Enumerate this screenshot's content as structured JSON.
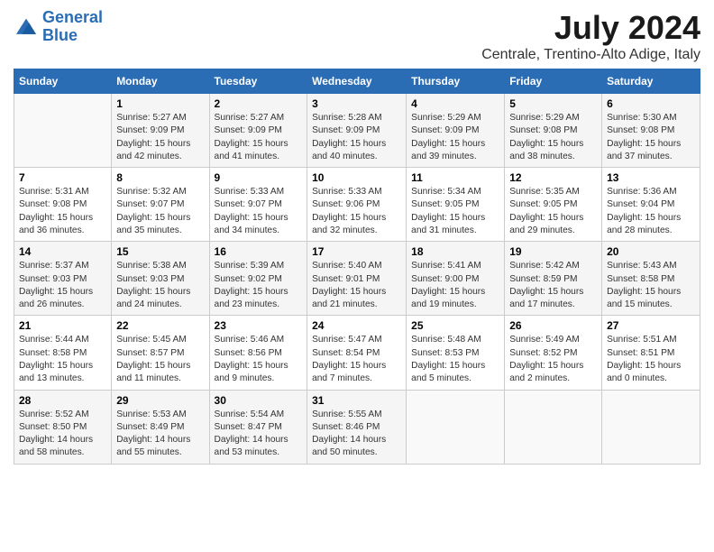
{
  "header": {
    "logo_line1": "General",
    "logo_line2": "Blue",
    "month": "July 2024",
    "location": "Centrale, Trentino-Alto Adige, Italy"
  },
  "weekdays": [
    "Sunday",
    "Monday",
    "Tuesday",
    "Wednesday",
    "Thursday",
    "Friday",
    "Saturday"
  ],
  "weeks": [
    [
      {
        "day": "",
        "info": ""
      },
      {
        "day": "1",
        "info": "Sunrise: 5:27 AM\nSunset: 9:09 PM\nDaylight: 15 hours\nand 42 minutes."
      },
      {
        "day": "2",
        "info": "Sunrise: 5:27 AM\nSunset: 9:09 PM\nDaylight: 15 hours\nand 41 minutes."
      },
      {
        "day": "3",
        "info": "Sunrise: 5:28 AM\nSunset: 9:09 PM\nDaylight: 15 hours\nand 40 minutes."
      },
      {
        "day": "4",
        "info": "Sunrise: 5:29 AM\nSunset: 9:09 PM\nDaylight: 15 hours\nand 39 minutes."
      },
      {
        "day": "5",
        "info": "Sunrise: 5:29 AM\nSunset: 9:08 PM\nDaylight: 15 hours\nand 38 minutes."
      },
      {
        "day": "6",
        "info": "Sunrise: 5:30 AM\nSunset: 9:08 PM\nDaylight: 15 hours\nand 37 minutes."
      }
    ],
    [
      {
        "day": "7",
        "info": "Sunrise: 5:31 AM\nSunset: 9:08 PM\nDaylight: 15 hours\nand 36 minutes."
      },
      {
        "day": "8",
        "info": "Sunrise: 5:32 AM\nSunset: 9:07 PM\nDaylight: 15 hours\nand 35 minutes."
      },
      {
        "day": "9",
        "info": "Sunrise: 5:33 AM\nSunset: 9:07 PM\nDaylight: 15 hours\nand 34 minutes."
      },
      {
        "day": "10",
        "info": "Sunrise: 5:33 AM\nSunset: 9:06 PM\nDaylight: 15 hours\nand 32 minutes."
      },
      {
        "day": "11",
        "info": "Sunrise: 5:34 AM\nSunset: 9:05 PM\nDaylight: 15 hours\nand 31 minutes."
      },
      {
        "day": "12",
        "info": "Sunrise: 5:35 AM\nSunset: 9:05 PM\nDaylight: 15 hours\nand 29 minutes."
      },
      {
        "day": "13",
        "info": "Sunrise: 5:36 AM\nSunset: 9:04 PM\nDaylight: 15 hours\nand 28 minutes."
      }
    ],
    [
      {
        "day": "14",
        "info": "Sunrise: 5:37 AM\nSunset: 9:03 PM\nDaylight: 15 hours\nand 26 minutes."
      },
      {
        "day": "15",
        "info": "Sunrise: 5:38 AM\nSunset: 9:03 PM\nDaylight: 15 hours\nand 24 minutes."
      },
      {
        "day": "16",
        "info": "Sunrise: 5:39 AM\nSunset: 9:02 PM\nDaylight: 15 hours\nand 23 minutes."
      },
      {
        "day": "17",
        "info": "Sunrise: 5:40 AM\nSunset: 9:01 PM\nDaylight: 15 hours\nand 21 minutes."
      },
      {
        "day": "18",
        "info": "Sunrise: 5:41 AM\nSunset: 9:00 PM\nDaylight: 15 hours\nand 19 minutes."
      },
      {
        "day": "19",
        "info": "Sunrise: 5:42 AM\nSunset: 8:59 PM\nDaylight: 15 hours\nand 17 minutes."
      },
      {
        "day": "20",
        "info": "Sunrise: 5:43 AM\nSunset: 8:58 PM\nDaylight: 15 hours\nand 15 minutes."
      }
    ],
    [
      {
        "day": "21",
        "info": "Sunrise: 5:44 AM\nSunset: 8:58 PM\nDaylight: 15 hours\nand 13 minutes."
      },
      {
        "day": "22",
        "info": "Sunrise: 5:45 AM\nSunset: 8:57 PM\nDaylight: 15 hours\nand 11 minutes."
      },
      {
        "day": "23",
        "info": "Sunrise: 5:46 AM\nSunset: 8:56 PM\nDaylight: 15 hours\nand 9 minutes."
      },
      {
        "day": "24",
        "info": "Sunrise: 5:47 AM\nSunset: 8:54 PM\nDaylight: 15 hours\nand 7 minutes."
      },
      {
        "day": "25",
        "info": "Sunrise: 5:48 AM\nSunset: 8:53 PM\nDaylight: 15 hours\nand 5 minutes."
      },
      {
        "day": "26",
        "info": "Sunrise: 5:49 AM\nSunset: 8:52 PM\nDaylight: 15 hours\nand 2 minutes."
      },
      {
        "day": "27",
        "info": "Sunrise: 5:51 AM\nSunset: 8:51 PM\nDaylight: 15 hours\nand 0 minutes."
      }
    ],
    [
      {
        "day": "28",
        "info": "Sunrise: 5:52 AM\nSunset: 8:50 PM\nDaylight: 14 hours\nand 58 minutes."
      },
      {
        "day": "29",
        "info": "Sunrise: 5:53 AM\nSunset: 8:49 PM\nDaylight: 14 hours\nand 55 minutes."
      },
      {
        "day": "30",
        "info": "Sunrise: 5:54 AM\nSunset: 8:47 PM\nDaylight: 14 hours\nand 53 minutes."
      },
      {
        "day": "31",
        "info": "Sunrise: 5:55 AM\nSunset: 8:46 PM\nDaylight: 14 hours\nand 50 minutes."
      },
      {
        "day": "",
        "info": ""
      },
      {
        "day": "",
        "info": ""
      },
      {
        "day": "",
        "info": ""
      }
    ]
  ]
}
